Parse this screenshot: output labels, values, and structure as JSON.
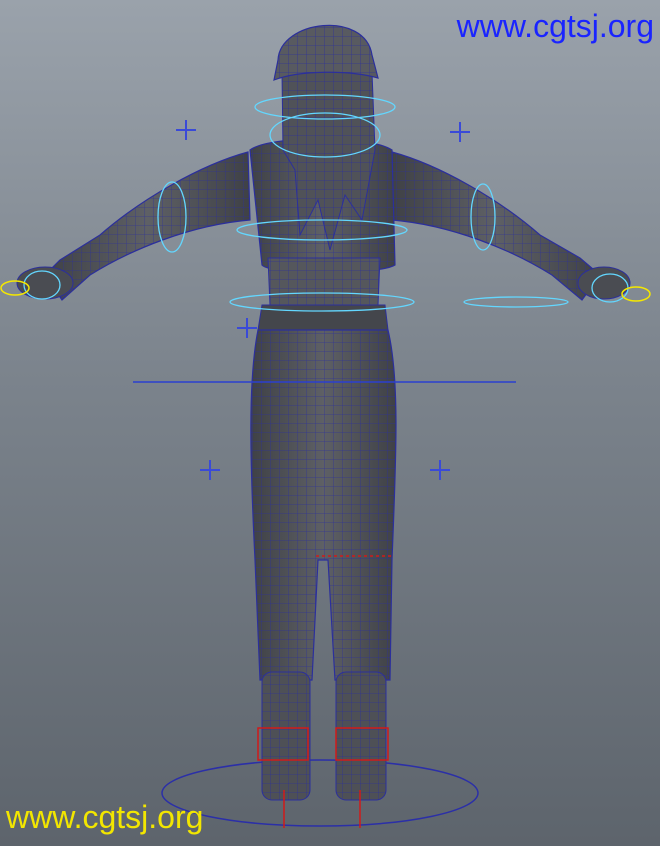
{
  "watermarks": {
    "top_text": "www.cgtsj.org",
    "bottom_text": "www.cgtsj.org",
    "top_color": "#1a24ff",
    "bottom_color": "#f2e600"
  },
  "viewport": {
    "background_top": "#9aa2ab",
    "background_bottom": "#5d646c",
    "mesh_fill": "#55575c",
    "wire_color": "#2b2f9c",
    "control_color": "#63d7ff",
    "locator_color": "#3a4ad8",
    "joint_color": "#d01a1a",
    "ik_handle_color": "#f5e800"
  }
}
